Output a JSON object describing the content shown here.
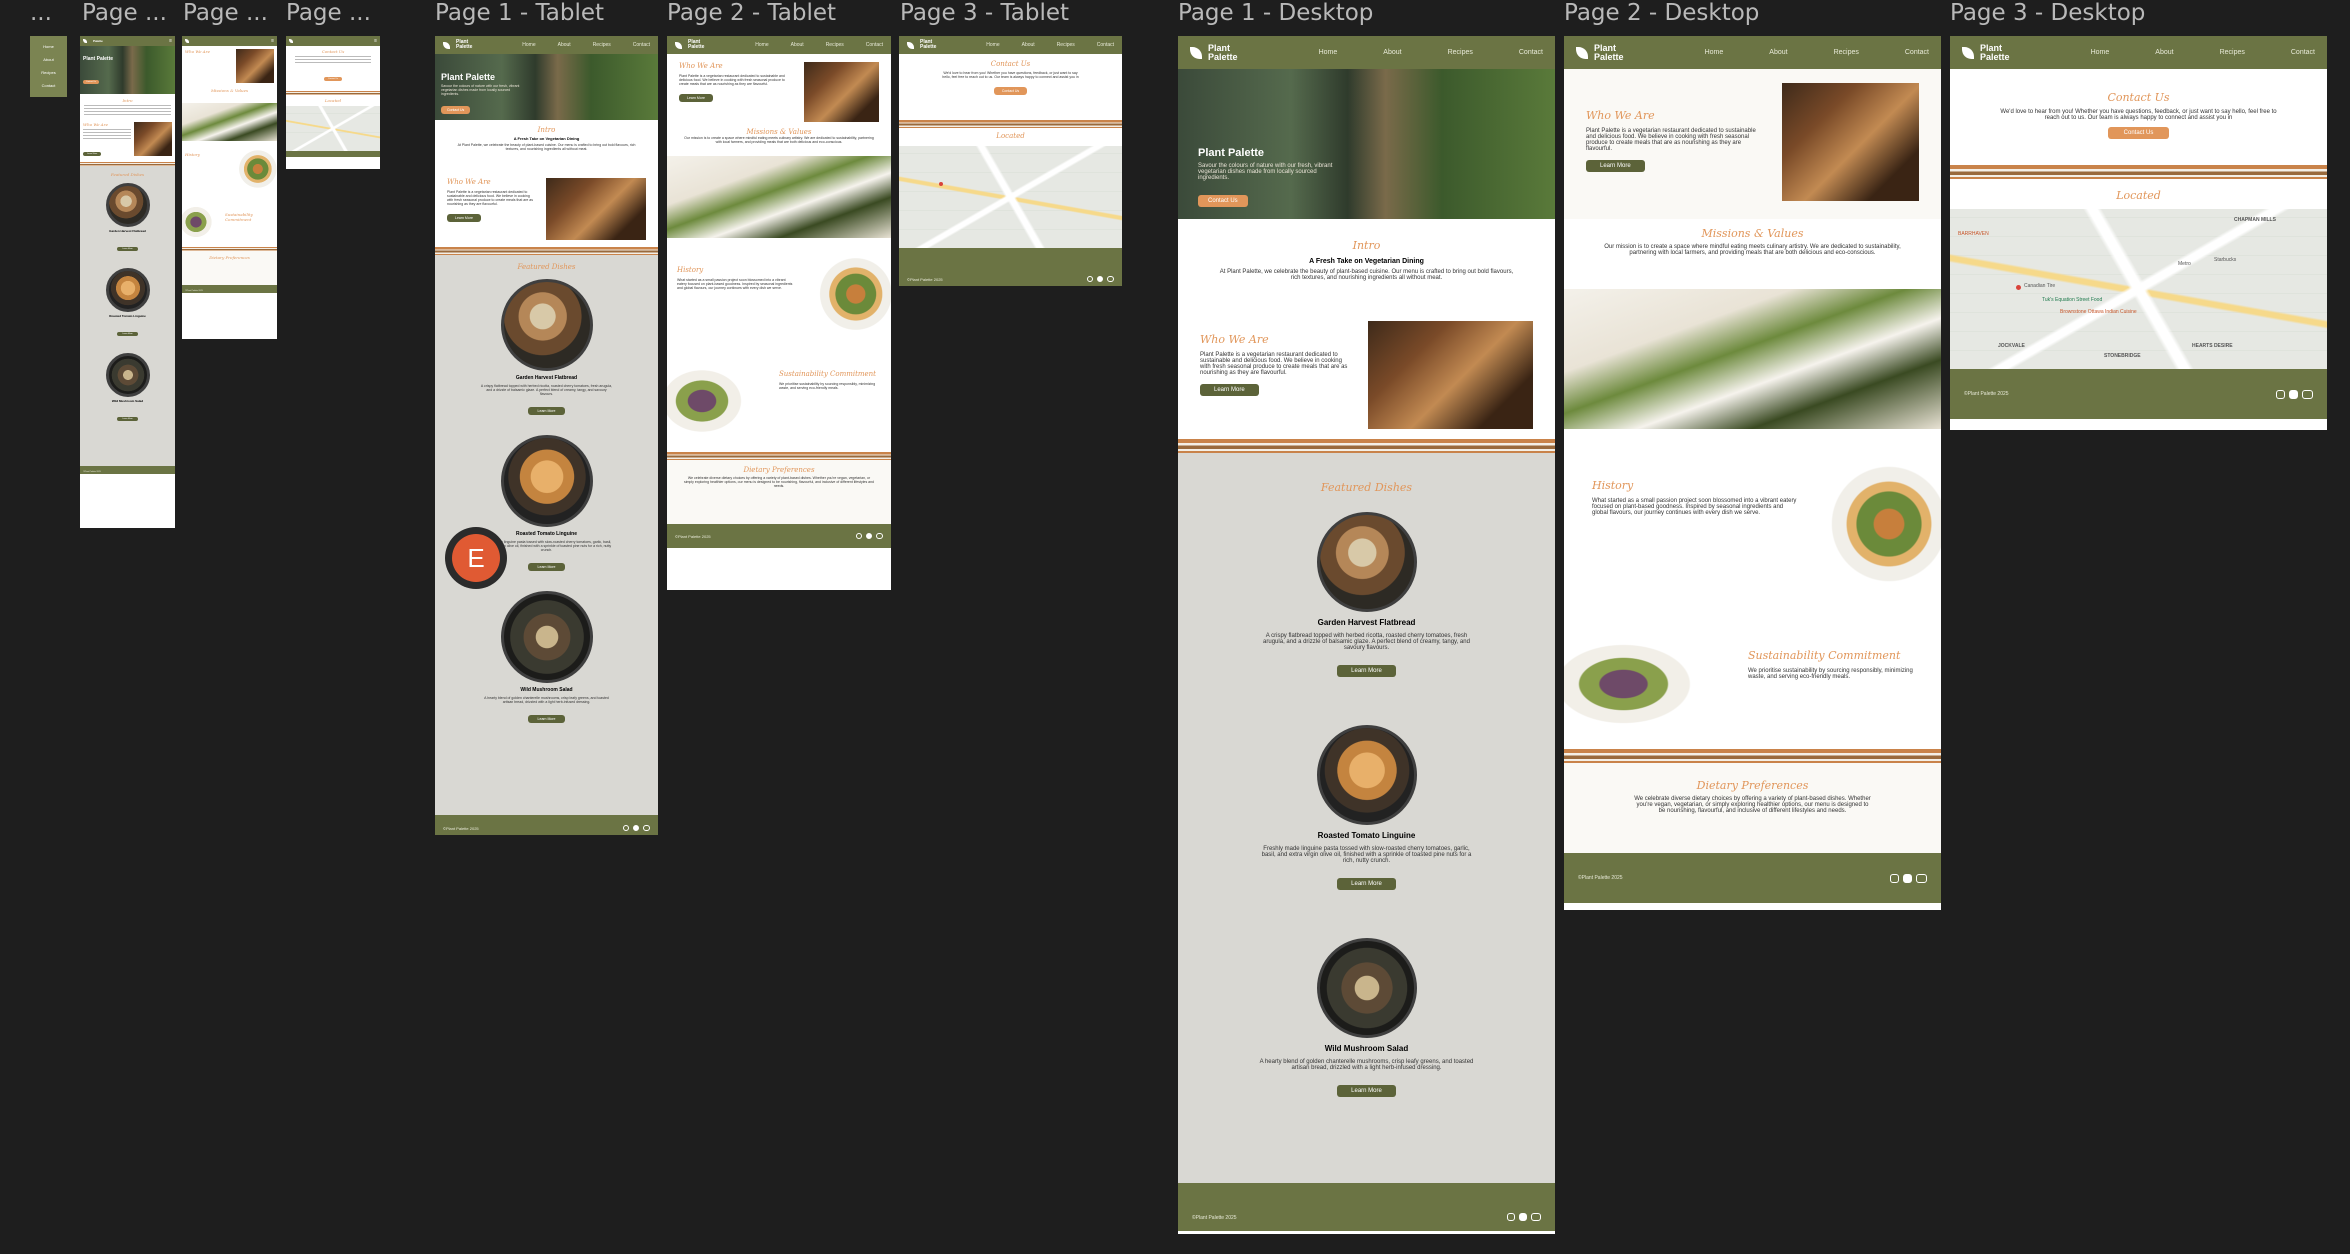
{
  "frames": {
    "f0": {
      "title": "..."
    },
    "f1": {
      "title": "Page ..."
    },
    "f2": {
      "title": "Page ..."
    },
    "f3": {
      "title": "Page ..."
    },
    "tab1": {
      "title": "Page 1 - Tablet"
    },
    "tab2": {
      "title": "Page 2 - Tablet"
    },
    "tab3": {
      "title": "Page 3 - Tablet"
    },
    "desk1": {
      "title": "Page 1 - Desktop"
    },
    "desk2": {
      "title": "Page 2 - Desktop"
    },
    "desk3": {
      "title": "Page 3 - Desktop"
    }
  },
  "brand": {
    "line1": "Plant",
    "line2": "Palette"
  },
  "nav": [
    "Home",
    "About",
    "Recipes",
    "Contact"
  ],
  "mobile_menu": [
    "Home",
    "About",
    "Recipes",
    "Contact"
  ],
  "hero": {
    "title": "Plant Palette",
    "subtitle": "Savour the colours of nature with our fresh, vibrant vegetarian dishes made from locally sourced ingredients.",
    "cta": "Contact Us"
  },
  "intro": {
    "heading": "Intro",
    "subheading": "A Fresh Take on Vegetarian Dining",
    "body": "At Plant Palette, we celebrate the beauty of plant-based cuisine. Our menu is crafted to bring out bold flavours, rich textures, and nourishing ingredients all without meat."
  },
  "who": {
    "heading": "Who We Are",
    "body": "Plant Palette is a vegetarian restaurant dedicated to sustainable and delicious food. We believe in cooking with fresh seasonal produce to create meals that are as nourishing as they are flavourful.",
    "cta": "Learn More"
  },
  "featured": {
    "heading": "Featured Dishes",
    "dishes": [
      {
        "name": "Garden Harvest Flatbread",
        "desc": "A crispy flatbread topped with herbed ricotta, roasted cherry tomatoes, fresh arugula, and a drizzle of balsamic glaze. A perfect blend of creamy, tangy, and savoury flavours.",
        "cta": "Learn More"
      },
      {
        "name": "Roasted Tomato Linguine",
        "desc": "Freshly made linguine pasta tossed with slow-roasted cherry tomatoes, garlic, basil, and extra virgin olive oil, finished with a sprinkle of toasted pine nuts for a rich, nutty crunch.",
        "cta": "Learn More"
      },
      {
        "name": "Wild Mushroom Salad",
        "desc": "A hearty blend of golden chanterelle mushrooms, crisp leafy greens, and toasted artisan bread, drizzled with a light herb-infused dressing.",
        "cta": "Learn More"
      }
    ]
  },
  "missions": {
    "heading": "Missions & Values",
    "body": "Our mission is to create a space where mindful eating meets culinary artistry. We are dedicated to sustainability, partnering with local farmers, and providing meals that are both delicious and eco-conscious."
  },
  "history": {
    "heading": "History",
    "body": "What started as a small passion project soon blossomed into a vibrant eatery focused on plant-based goodness. Inspired by seasonal ingredients and global flavours, our journey continues with every dish we serve."
  },
  "sustain": {
    "heading": "Sustainability Commitment",
    "body": "We prioritise sustainability by sourcing responsibly, minimizing waste, and serving eco-friendly meals."
  },
  "dietary": {
    "heading": "Dietary Preferences",
    "body": "We celebrate diverse dietary choices by offering a variety of plant-based dishes. Whether you're vegan, vegetarian, or simply exploring healthier options, our menu is designed to be nourishing, flavourful, and inclusive of different lifestyles and needs."
  },
  "contact": {
    "heading": "Contact Us",
    "body": "We'd love to hear from you! Whether you have questions, feedback, or just want to say hello, feel free to reach out to us. Our team is always happy to connect and assist you in",
    "cta": "Contact Us",
    "located": "Located"
  },
  "map_labels": {
    "a": "Canadian Tire",
    "b": "Tuk's Equation Street Food",
    "c": "Brownstone Ottawa Indian Cuisine",
    "d": "HEARTS DESIRE",
    "e": "STONEBRIDGE",
    "f": "JOCKVALE",
    "g": "CHAPMAN MILLS",
    "h": "BARRHAVEN",
    "i": "Starbucks",
    "j": "Metro"
  },
  "footer": {
    "copyright": "©Plant Palette 2025"
  },
  "avatar": {
    "letter": "E",
    "color": "#e05a33"
  }
}
